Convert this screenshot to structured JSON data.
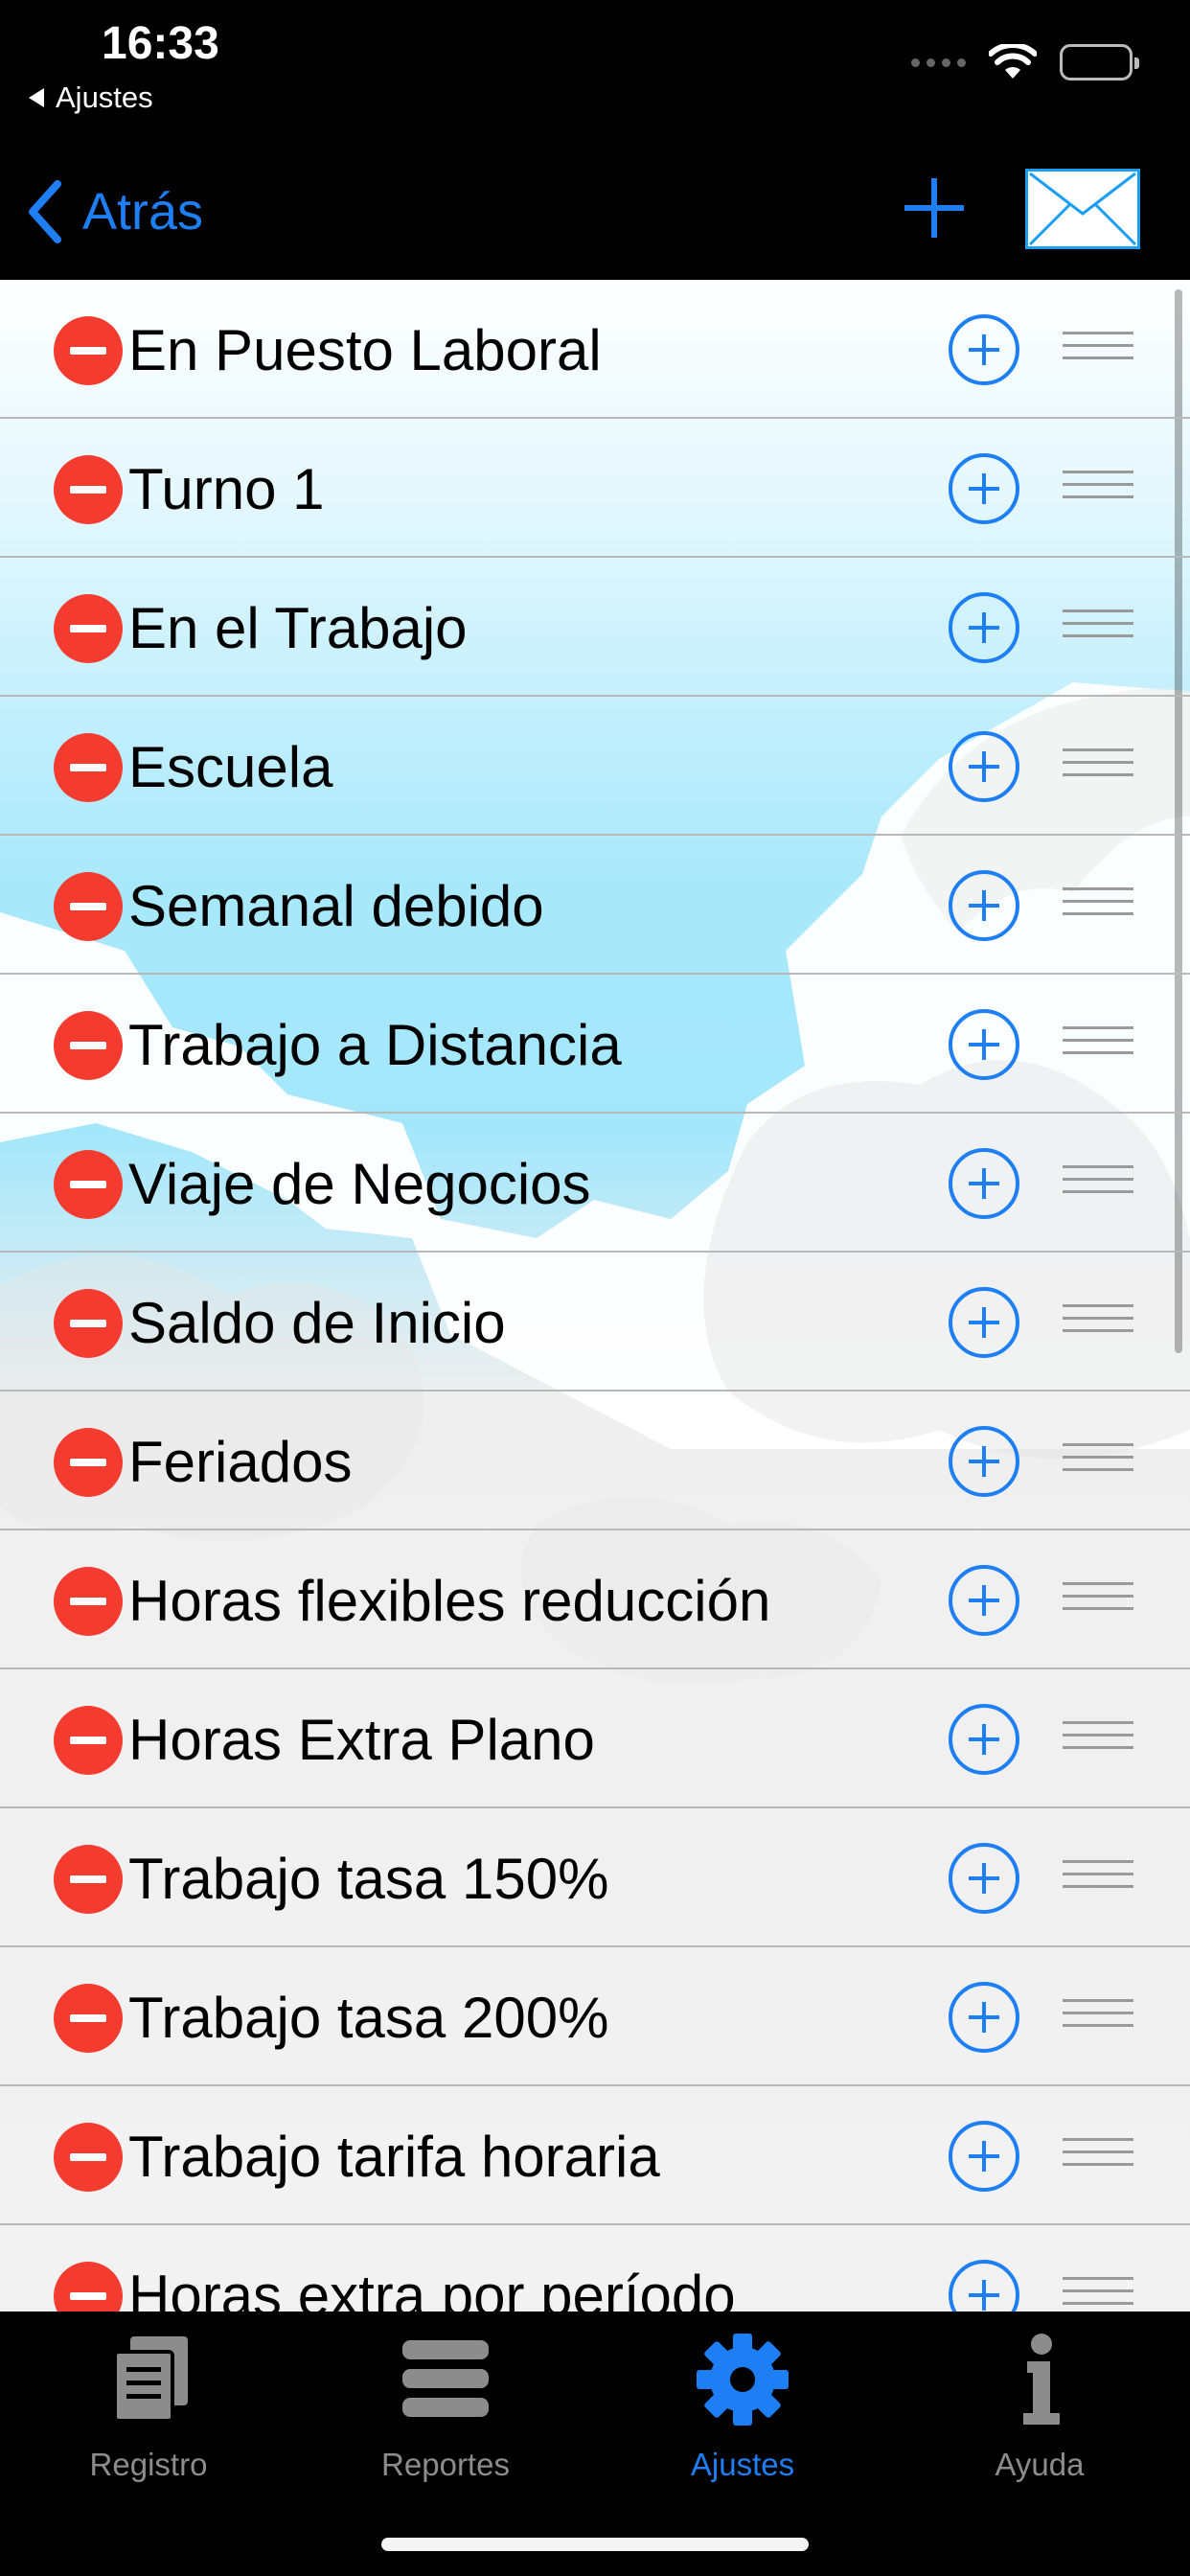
{
  "status_bar": {
    "time": "16:33",
    "back_app": "Ajustes"
  },
  "nav": {
    "back_label": "Atrás",
    "add_icon": "plus-icon",
    "mail_icon": "envelope-icon",
    "accent_color": "#1e7ff4"
  },
  "list": {
    "items": [
      {
        "label": "En Puesto Laboral"
      },
      {
        "label": "Turno 1"
      },
      {
        "label": "En el Trabajo"
      },
      {
        "label": "Escuela"
      },
      {
        "label": "Semanal debido"
      },
      {
        "label": "Trabajo a Distancia"
      },
      {
        "label": "Viaje de Negocios"
      },
      {
        "label": "Saldo de Inicio"
      },
      {
        "label": "Feriados"
      },
      {
        "label": "Horas flexibles reducción"
      },
      {
        "label": "Horas Extra Plano"
      },
      {
        "label": "Trabajo tasa 150%"
      },
      {
        "label": "Trabajo tasa 200%"
      },
      {
        "label": "Trabajo tarifa horaria"
      },
      {
        "label": "Horas extra por período"
      }
    ],
    "delete_color": "#f43b30"
  },
  "tabs": [
    {
      "label": "Registro",
      "icon": "document-icon"
    },
    {
      "label": "Reportes",
      "icon": "list-bars-icon"
    },
    {
      "label": "Ajustes",
      "icon": "gear-icon",
      "active": true
    },
    {
      "label": "Ayuda",
      "icon": "info-icon"
    }
  ]
}
